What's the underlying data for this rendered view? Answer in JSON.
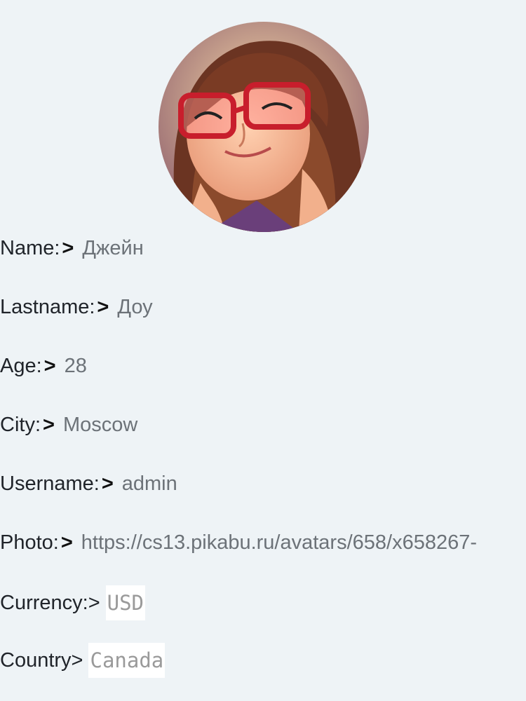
{
  "profile": {
    "avatar_icon": "avatar-photo",
    "fields": [
      {
        "label": "Name:",
        "arrow": ">",
        "value": "Джейн"
      },
      {
        "label": "Lastname:",
        "arrow": ">",
        "value": "Доу"
      },
      {
        "label": "Age:",
        "arrow": ">",
        "value": "28"
      },
      {
        "label": "City:",
        "arrow": ">",
        "value": "Moscow"
      },
      {
        "label": "Username:",
        "arrow": ">",
        "value": "admin"
      },
      {
        "label": "Photo:",
        "arrow": ">",
        "value": "https://cs13.pikabu.ru/avatars/658/x658267-"
      }
    ],
    "currency": {
      "label": "Currency:>",
      "value": "USD"
    },
    "country": {
      "label": "Country>",
      "value": "Canada"
    }
  }
}
